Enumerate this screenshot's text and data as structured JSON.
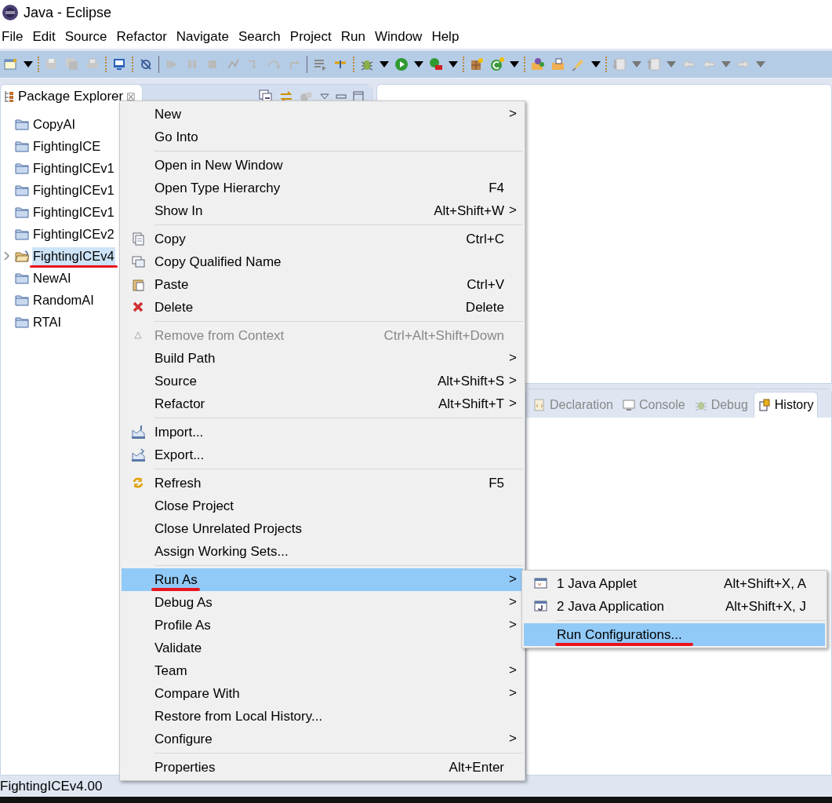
{
  "window": {
    "title": "Java - Eclipse"
  },
  "menu_bar": [
    "File",
    "Edit",
    "Source",
    "Refactor",
    "Navigate",
    "Search",
    "Project",
    "Run",
    "Window",
    "Help"
  ],
  "package_explorer": {
    "title": "Package Explorer",
    "close": "☒",
    "projects": [
      {
        "name": "CopyAI",
        "selected": false,
        "open": false
      },
      {
        "name": "FightingICE",
        "selected": false,
        "open": false
      },
      {
        "name": "FightingICEv1",
        "selected": false,
        "open": false
      },
      {
        "name": "FightingICEv1",
        "selected": false,
        "open": false
      },
      {
        "name": "FightingICEv1",
        "selected": false,
        "open": false
      },
      {
        "name": "FightingICEv2",
        "selected": false,
        "open": false
      },
      {
        "name": "FightingICEv4",
        "selected": true,
        "open": true
      },
      {
        "name": "NewAI",
        "selected": false,
        "open": false
      },
      {
        "name": "RandomAI",
        "selected": false,
        "open": false
      },
      {
        "name": "RTAI",
        "selected": false,
        "open": false
      }
    ]
  },
  "view_tabs": [
    {
      "label": "Declaration",
      "kind": "declaration",
      "selected": false
    },
    {
      "label": "Console",
      "kind": "console",
      "selected": false
    },
    {
      "label": "Debug",
      "kind": "debug",
      "selected": false
    },
    {
      "label": "History",
      "kind": "history",
      "selected": true
    }
  ],
  "context_menu": {
    "groups": [
      [
        {
          "label": "New",
          "submenu": true,
          "selected": false,
          "disabled": false
        },
        {
          "label": "Go Into",
          "selected": false,
          "disabled": false
        }
      ],
      [
        {
          "label": "Open in New Window",
          "selected": false,
          "disabled": false
        },
        {
          "label": "Open Type Hierarchy",
          "shortcut": "F4",
          "selected": false,
          "disabled": false
        },
        {
          "label": "Show In",
          "shortcut": "Alt+Shift+W",
          "submenu": true,
          "selected": false,
          "disabled": false
        }
      ],
      [
        {
          "label": "Copy",
          "shortcut": "Ctrl+C",
          "kind": "copy",
          "selected": false,
          "disabled": false
        },
        {
          "label": "Copy Qualified Name",
          "kind": "copy-name",
          "selected": false,
          "disabled": false
        },
        {
          "label": "Paste",
          "shortcut": "Ctrl+V",
          "kind": "paste",
          "selected": false,
          "disabled": false
        },
        {
          "label": "Delete",
          "shortcut": "Delete",
          "kind": "delete",
          "selected": false,
          "disabled": false
        }
      ],
      [
        {
          "label": "Remove from Context",
          "shortcut": "Ctrl+Alt+Shift+Down",
          "kind": "remove",
          "selected": false,
          "disabled": true
        },
        {
          "label": "Build Path",
          "submenu": true,
          "selected": false,
          "disabled": false
        },
        {
          "label": "Source",
          "shortcut": "Alt+Shift+S",
          "submenu": true,
          "selected": false,
          "disabled": false
        },
        {
          "label": "Refactor",
          "shortcut": "Alt+Shift+T",
          "submenu": true,
          "selected": false,
          "disabled": false
        }
      ],
      [
        {
          "label": "Import...",
          "kind": "import",
          "selected": false,
          "disabled": false
        },
        {
          "label": "Export...",
          "kind": "export",
          "selected": false,
          "disabled": false
        }
      ],
      [
        {
          "label": "Refresh",
          "shortcut": "F5",
          "kind": "refresh",
          "selected": false,
          "disabled": false
        },
        {
          "label": "Close Project",
          "selected": false,
          "disabled": false
        },
        {
          "label": "Close Unrelated Projects",
          "selected": false,
          "disabled": false
        },
        {
          "label": "Assign Working Sets...",
          "selected": false,
          "disabled": false
        }
      ],
      [
        {
          "label": "Run As",
          "submenu": true,
          "selected": true,
          "disabled": false
        },
        {
          "label": "Debug As",
          "submenu": true,
          "selected": false,
          "disabled": false
        },
        {
          "label": "Profile As",
          "submenu": true,
          "selected": false,
          "disabled": false
        },
        {
          "label": "Validate",
          "selected": false,
          "disabled": false
        },
        {
          "label": "Team",
          "submenu": true,
          "selected": false,
          "disabled": false
        },
        {
          "label": "Compare With",
          "submenu": true,
          "selected": false,
          "disabled": false
        },
        {
          "label": "Restore from Local History...",
          "selected": false,
          "disabled": false
        },
        {
          "label": "Configure",
          "submenu": true,
          "selected": false,
          "disabled": false
        }
      ],
      [
        {
          "label": "Properties",
          "shortcut": "Alt+Enter",
          "selected": false,
          "disabled": false
        }
      ]
    ],
    "submenu_arrow": ">"
  },
  "run_as_submenu": {
    "groups": [
      [
        {
          "label": "1 Java Applet",
          "shortcut": "Alt+Shift+X, A",
          "kind": "applet",
          "selected": false
        },
        {
          "label": "2 Java Application",
          "shortcut": "Alt+Shift+X, J",
          "kind": "application",
          "selected": false
        }
      ],
      [
        {
          "label": "Run Configurations...",
          "selected": true
        }
      ]
    ]
  },
  "status_bar": {
    "text": "FightingICEv4.00"
  }
}
